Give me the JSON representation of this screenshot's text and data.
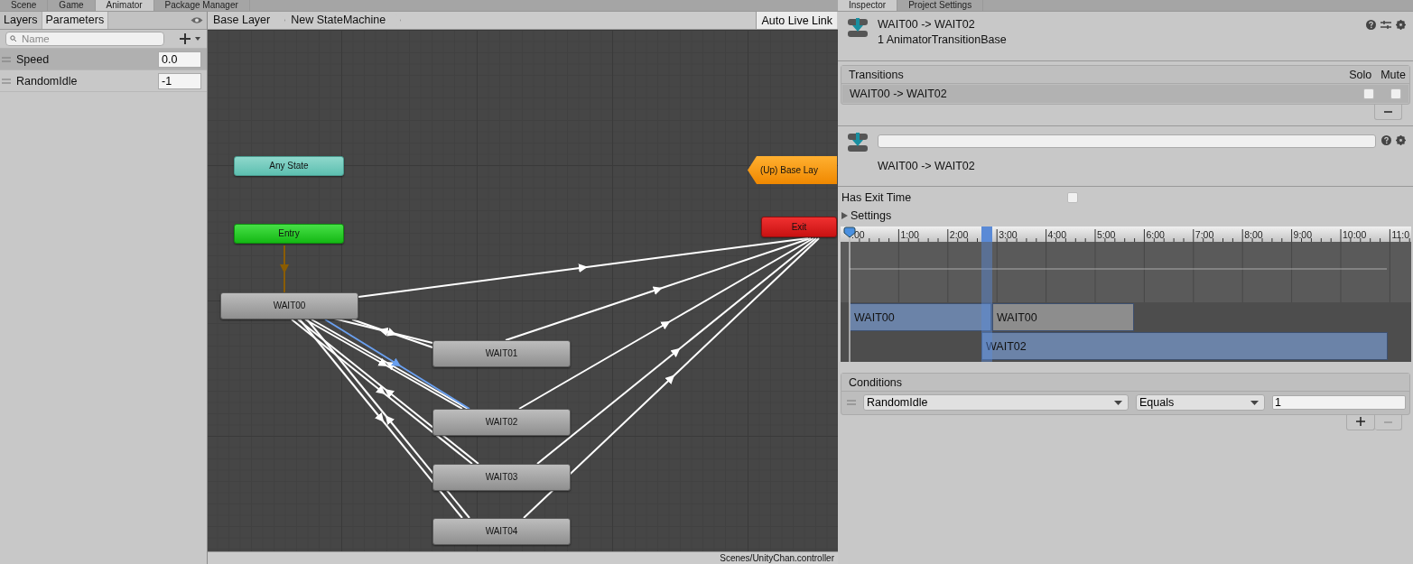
{
  "editor_tabs": [
    {
      "label": "Scene",
      "selected": false
    },
    {
      "label": "Game",
      "selected": false
    },
    {
      "label": "Animator",
      "selected": true
    },
    {
      "label": "Package Manager",
      "selected": false
    }
  ],
  "left_panel": {
    "tabs": [
      {
        "label": "Layers",
        "selected": false
      },
      {
        "label": "Parameters",
        "selected": true
      }
    ],
    "search": {
      "placeholder": "Name"
    },
    "parameters": [
      {
        "name": "Speed",
        "value": "0.0",
        "selected": true
      },
      {
        "name": "RandomIdle",
        "value": "-1",
        "selected": false
      }
    ]
  },
  "graph": {
    "breadcrumbs": [
      "Base Layer",
      "New StateMachine"
    ],
    "auto_live_link": "Auto Live Link",
    "nodes": [
      {
        "label": "Any State",
        "kind": "any"
      },
      {
        "label": "Entry",
        "kind": "entry"
      },
      {
        "label": "(Up) Base Lay",
        "kind": "up"
      },
      {
        "label": "Exit",
        "kind": "exit"
      },
      {
        "label": "WAIT00",
        "kind": "state"
      },
      {
        "label": "WAIT01",
        "kind": "state"
      },
      {
        "label": "WAIT02",
        "kind": "state"
      },
      {
        "label": "WAIT03",
        "kind": "state"
      },
      {
        "label": "WAIT04",
        "kind": "state"
      }
    ],
    "status": "Scenes/UnityChan.controller"
  },
  "inspector_tabs": [
    {
      "label": "Inspector",
      "selected": true
    },
    {
      "label": "Project Settings",
      "selected": false
    }
  ],
  "inspector": {
    "title": "WAIT00 -> WAIT02",
    "subtitle": "1 AnimatorTransitionBase",
    "transitions": {
      "header": "Transitions",
      "solo_label": "Solo",
      "mute_label": "Mute",
      "rows": [
        {
          "name": "WAIT00 -> WAIT02",
          "selected": true,
          "solo": false,
          "mute": false
        }
      ]
    },
    "caption": "WAIT00 -> WAIT02",
    "has_exit_time": {
      "label": "Has Exit Time",
      "checked": false
    },
    "settings": {
      "label": "Settings",
      "expanded": false
    },
    "timeline": {
      "ticks": [
        ":00",
        "1:00",
        "2:00",
        "3:00",
        "4:00",
        "5:00",
        "6:00",
        "7:00",
        "8:00",
        "9:00",
        "10:00",
        "11:0"
      ],
      "clips": [
        {
          "label": "WAIT00",
          "kind": "source"
        },
        {
          "label": "WAIT00",
          "kind": "source-after"
        },
        {
          "label": "WAIT02",
          "kind": "target"
        }
      ]
    },
    "conditions": {
      "header": "Conditions",
      "rows": [
        {
          "parameter": "RandomIdle",
          "mode": "Equals",
          "value": "1"
        }
      ]
    }
  }
}
